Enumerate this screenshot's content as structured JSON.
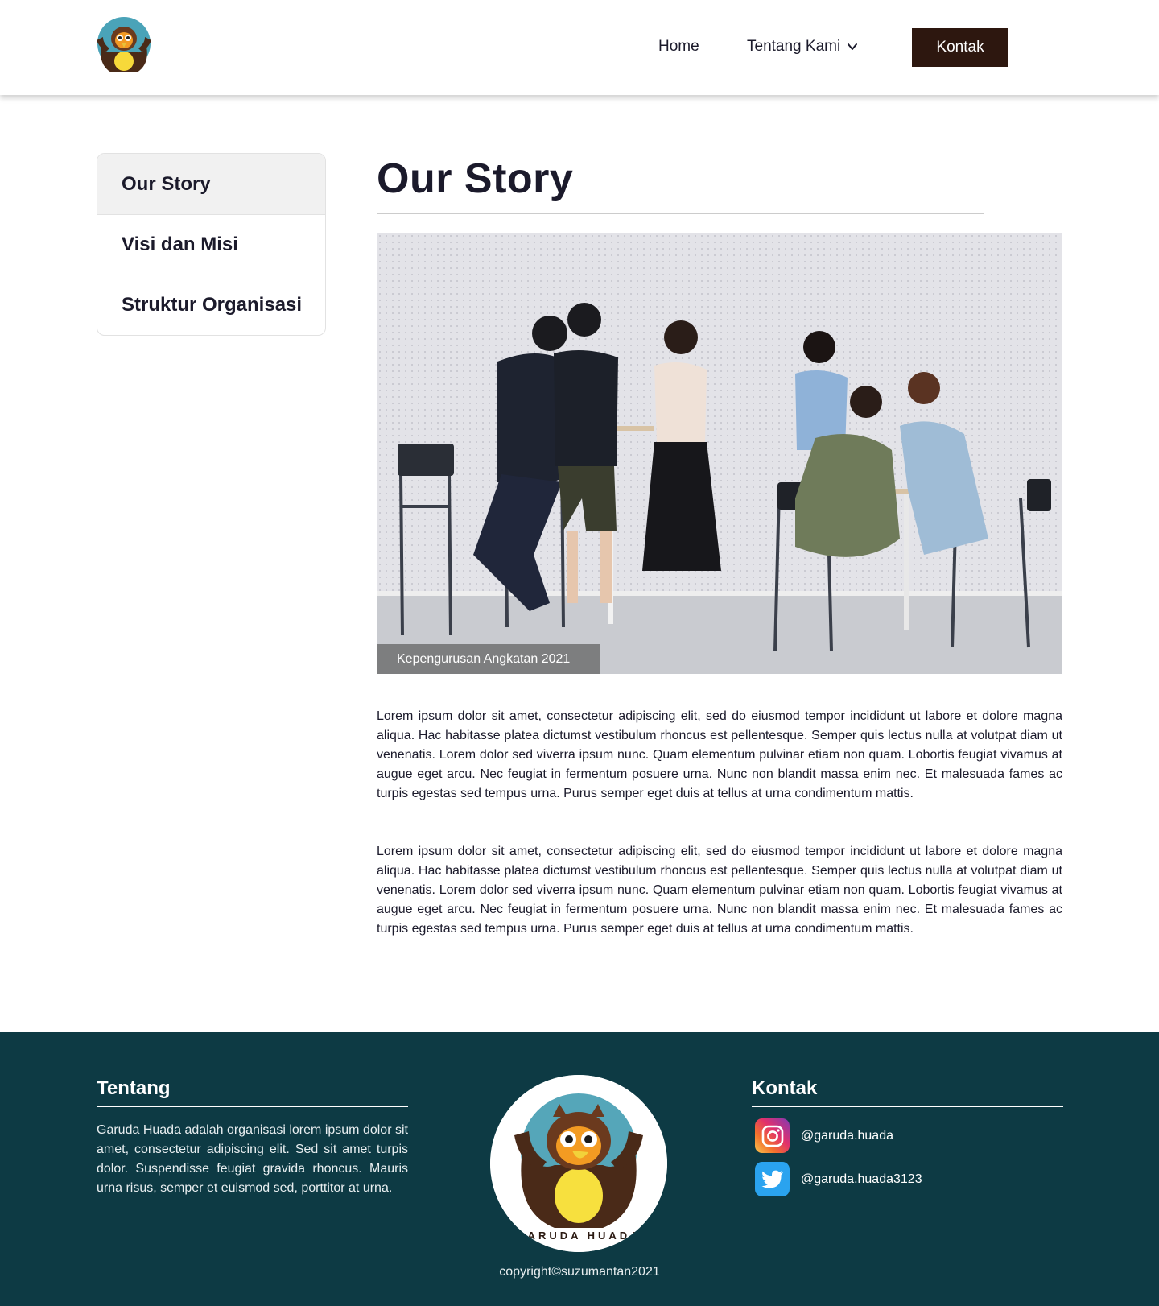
{
  "header": {
    "logo_alt": "GARUDA HUADA",
    "nav": {
      "home": "Home",
      "about": "Tentang Kami",
      "contact_button": "Kontak"
    }
  },
  "sidebar": {
    "items": [
      {
        "label": "Our Story",
        "active": true
      },
      {
        "label": "Visi dan Misi",
        "active": false
      },
      {
        "label": "Struktur Organisasi",
        "active": false
      }
    ]
  },
  "main": {
    "title": "Our Story",
    "photo_caption": "Kepengurusan Angkatan 2021",
    "paragraphs": [
      "Lorem ipsum dolor sit amet, consectetur adipiscing elit, sed do eiusmod tempor incididunt ut labore et dolore magna aliqua. Hac habitasse platea dictumst vestibulum rhoncus est pellentesque. Semper quis lectus nulla at volutpat diam ut venenatis. Lorem dolor sed viverra ipsum nunc. Quam elementum pulvinar etiam non quam. Lobortis feugiat vivamus at augue eget arcu. Nec feugiat in fermentum posuere urna. Nunc non blandit massa enim nec. Et malesuada fames ac turpis egestas sed tempus urna. Purus semper eget duis at tellus at urna condimentum mattis.",
      "Lorem ipsum dolor sit amet, consectetur adipiscing elit, sed do eiusmod tempor incididunt ut labore et dolore magna aliqua. Hac habitasse platea dictumst vestibulum rhoncus est pellentesque. Semper quis lectus nulla at volutpat diam ut venenatis. Lorem dolor sed viverra ipsum nunc. Quam elementum pulvinar etiam non quam. Lobortis feugiat vivamus at augue eget arcu. Nec feugiat in fermentum posuere urna. Nunc non blandit massa enim nec. Et malesuada fames ac turpis egestas sed tempus urna. Purus semper eget duis at tellus at urna condimentum mattis."
    ]
  },
  "footer": {
    "about_heading": "Tentang",
    "about_text": "Garuda Huada adalah organisasi lorem ipsum dolor sit amet, consectetur adipiscing elit. Sed sit amet turpis dolor. Suspendisse feugiat gravida rhoncus. Mauris urna risus, semper et euismod sed, porttitor at urna.",
    "logo_text": "GARUDA HUADA",
    "contact_heading": "Kontak",
    "instagram": "@garuda.huada",
    "twitter": "@garuda.huada3123",
    "copyright": "copyright©suzumantan2021"
  },
  "colors": {
    "header_button": "#2d170f",
    "footer_bg": "#0d3a44",
    "text": "#1b1a2b"
  },
  "icons": [
    "owl-logo-icon",
    "chevron-down-icon",
    "instagram-icon",
    "twitter-icon"
  ]
}
